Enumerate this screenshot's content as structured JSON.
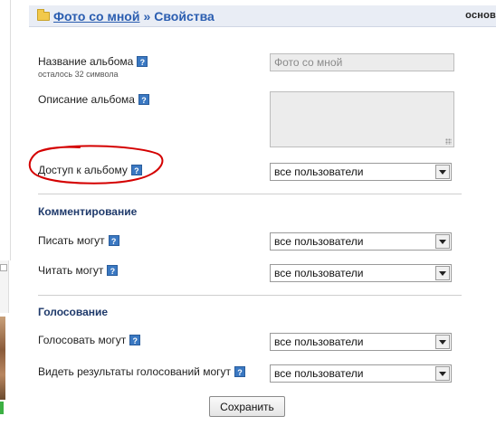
{
  "header": {
    "album_link": "Фото со мной",
    "separator": "»",
    "current": "Свойства",
    "right_text": "основ"
  },
  "fields": {
    "album_name": {
      "label": "Название альбома",
      "hint": "осталось 32 символа",
      "value": "Фото со мной"
    },
    "album_description": {
      "label": "Описание альбома",
      "value": ""
    },
    "album_access": {
      "label": "Доступ к альбому",
      "value": "все пользователи"
    }
  },
  "commenting": {
    "title": "Комментирование",
    "write": {
      "label": "Писать могут",
      "value": "все пользователи"
    },
    "read": {
      "label": "Читать могут",
      "value": "все пользователи"
    }
  },
  "voting": {
    "title": "Голосование",
    "vote": {
      "label": "Голосовать могут",
      "value": "все пользователи"
    },
    "results": {
      "label": "Видеть результаты голосований могут",
      "value": "все пользователи"
    }
  },
  "help_glyph": "?",
  "save_label": "Сохранить",
  "colors": {
    "link": "#2a5db0",
    "header_bg": "#e9edf5",
    "annotation": "#d40000"
  }
}
